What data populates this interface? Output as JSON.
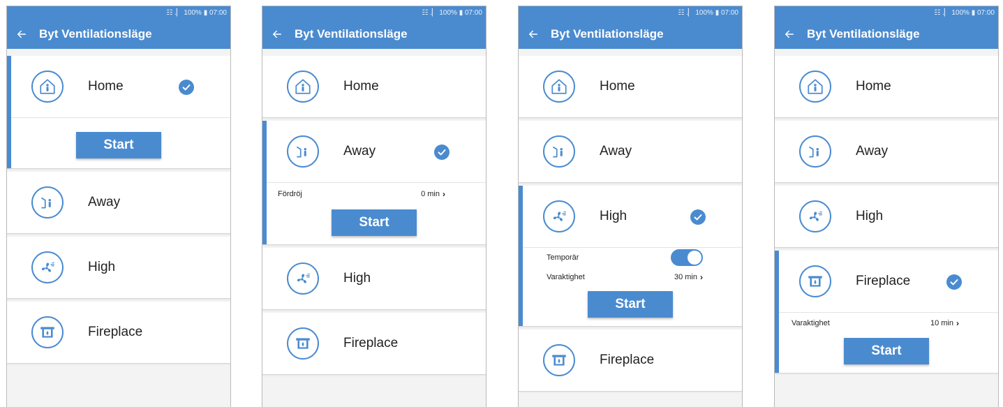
{
  "status": {
    "text": "☷ .▏ 100% ▮ 07:00"
  },
  "appbar": {
    "title": "Byt Ventilationsläge"
  },
  "modes": {
    "home": "Home",
    "away": "Away",
    "high": "High",
    "fireplace": "Fireplace"
  },
  "options": {
    "delay_label": "Fördröj",
    "delay_value": "0 min",
    "temporary_label": "Temporär",
    "duration_label": "Varaktighet",
    "high_duration": "30 min",
    "fireplace_duration": "10 min"
  },
  "buttons": {
    "start": "Start"
  },
  "colors": {
    "accent": "#4a8bd0",
    "card": "#ffffff",
    "background": "#f3f3f3"
  }
}
